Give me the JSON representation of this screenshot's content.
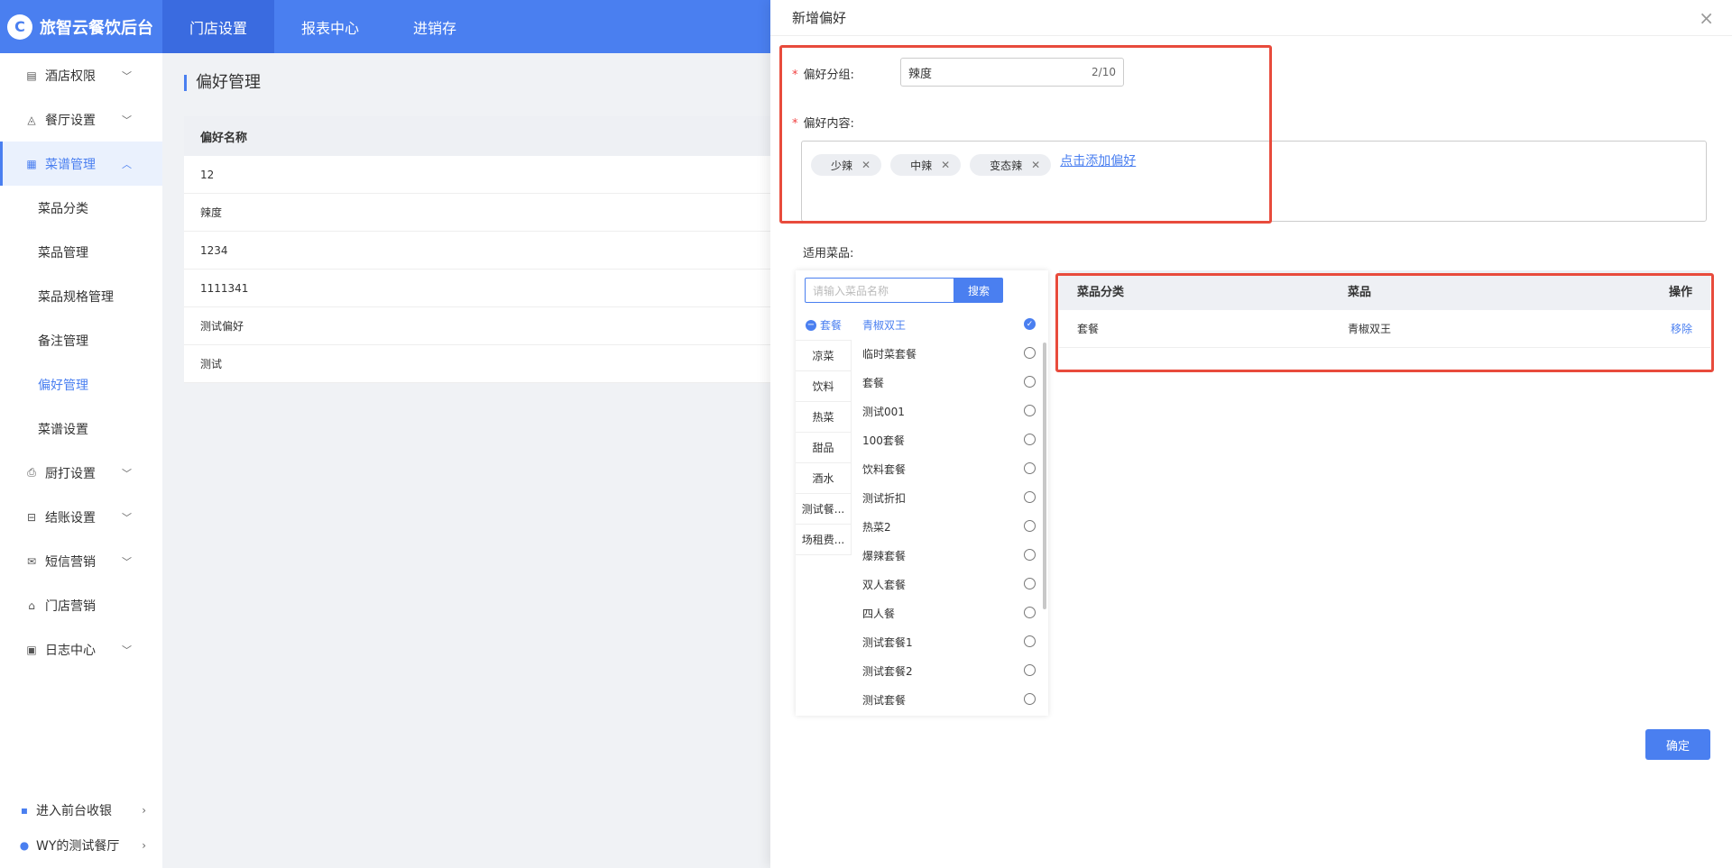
{
  "brand": {
    "name": "旅智云餐饮后台",
    "logo_icon": "logo-icon"
  },
  "topnav": [
    {
      "label": "门店设置",
      "active": true
    },
    {
      "label": "报表中心",
      "active": false
    },
    {
      "label": "进销存",
      "active": false
    }
  ],
  "sidebar": {
    "items": [
      {
        "label": "酒店权限",
        "icon": "building-icon",
        "glyph": "▤"
      },
      {
        "label": "餐厅设置",
        "icon": "bell-icon",
        "glyph": "◬"
      },
      {
        "label": "菜谱管理",
        "icon": "grid-icon",
        "glyph": "▦"
      },
      {
        "label": "厨打设置",
        "icon": "printer-icon",
        "glyph": "⎙"
      },
      {
        "label": "结账设置",
        "icon": "receipt-icon",
        "glyph": "⊟"
      },
      {
        "label": "短信营销",
        "icon": "mail-icon",
        "glyph": "✉"
      },
      {
        "label": "门店营销",
        "icon": "store-icon",
        "glyph": "⌂"
      },
      {
        "label": "日志中心",
        "icon": "document-icon",
        "glyph": "▣"
      }
    ],
    "submenu": [
      "菜品分类",
      "菜品管理",
      "菜品规格管理",
      "备注管理",
      "偏好管理",
      "菜谱设置"
    ],
    "footer": [
      {
        "label": "进入前台收银",
        "icon": "cashier-icon",
        "glyph": "▪"
      },
      {
        "label": "WY的测试餐厅",
        "icon": "location-pin-icon",
        "glyph": "●"
      }
    ]
  },
  "main": {
    "title": "偏好管理",
    "table_header": "偏好名称",
    "rows": [
      "12",
      "辣度",
      "1234",
      "1111341",
      "测试偏好",
      "测试"
    ]
  },
  "drawer": {
    "title": "新增偏好",
    "group_label": "偏好分组:",
    "group_value": "辣度",
    "group_count": "2/10",
    "content_label": "偏好内容:",
    "tags": [
      "少辣",
      "中辣",
      "变态辣"
    ],
    "add_link": "点击添加偏好",
    "dishes_label": "适用菜品:",
    "search_placeholder": "请输入菜品名称",
    "search_button": "搜索",
    "categories": [
      "套餐",
      "凉菜",
      "饮料",
      "热菜",
      "甜品",
      "酒水",
      "测试餐...",
      "场租费..."
    ],
    "dishes": [
      "青椒双王",
      "临时菜套餐",
      "套餐",
      "测试001",
      "100套餐",
      "饮料套餐",
      "测试折扣",
      "热菜2",
      "爆辣套餐",
      "双人套餐",
      "四人餐",
      "测试套餐1",
      "测试套餐2",
      "测试套餐"
    ],
    "selected_table": {
      "headers": [
        "菜品分类",
        "菜品",
        "操作"
      ],
      "rows": [
        {
          "category": "套餐",
          "dish": "青椒双王",
          "action": "移除"
        }
      ]
    },
    "confirm": "确定"
  }
}
